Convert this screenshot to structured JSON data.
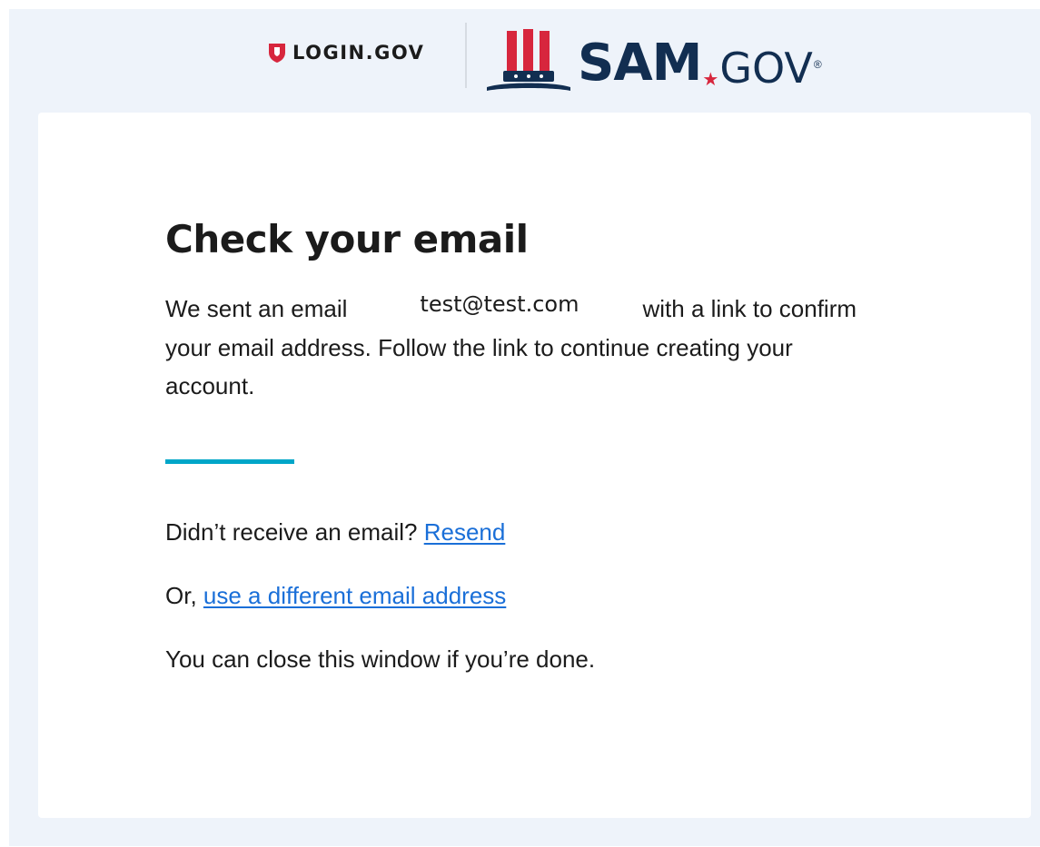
{
  "header": {
    "login_logo_text": "LOGIN.GOV",
    "sam_logo_text": "SAM",
    "sam_logo_suffix": "GOV",
    "sam_logo_reg": "®"
  },
  "main": {
    "title": "Check your email",
    "message_prefix": "We sent an email",
    "email": "test@test.com",
    "message_suffix": "with a link to confirm your email address. Follow the link to continue creating your account.",
    "resend_prompt": "Didn’t receive an email?",
    "resend_link": "Resend",
    "different_prefix": "Or,",
    "different_link": "use a different email address",
    "close_note": "You can close this window if you’re done."
  },
  "colors": {
    "page_bg": "#eef3fa",
    "card_bg": "#ffffff",
    "accent_bar": "#00a6c8",
    "link": "#1a6fd8",
    "login_red": "#d7263d",
    "sam_navy": "#122e51"
  },
  "icons": {
    "login_shield": "shield-icon",
    "sam_hat": "uncle-sam-hat-icon",
    "star": "star-icon"
  }
}
